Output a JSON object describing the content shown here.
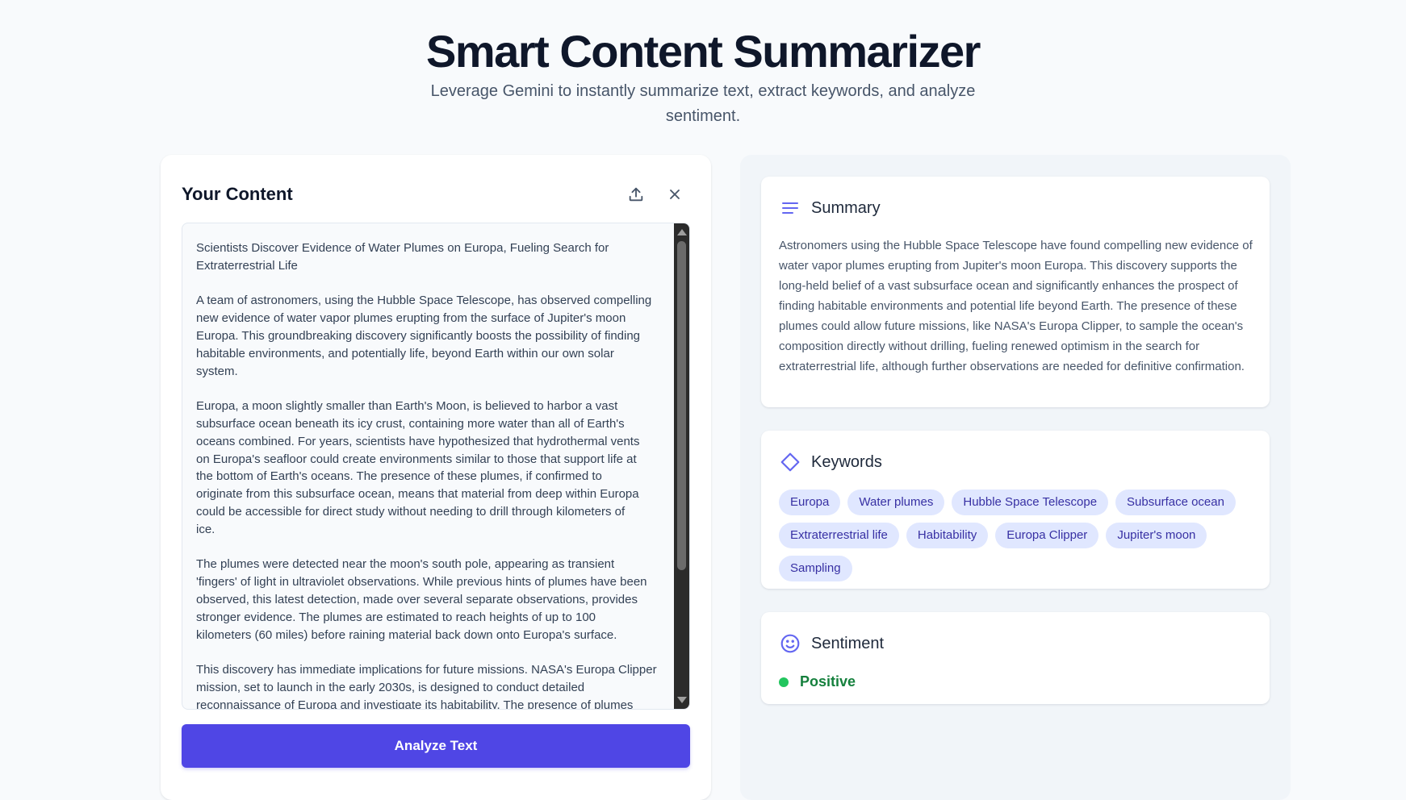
{
  "header": {
    "title": "Smart Content Summarizer",
    "subtitle": "Leverage Gemini to instantly summarize text, extract keywords, and analyze sentiment."
  },
  "input_panel": {
    "title": "Your Content",
    "upload_icon": "upload-icon",
    "close_icon": "close-icon",
    "text": "Scientists Discover Evidence of Water Plumes on Europa, Fueling Search for\nExtraterrestrial Life\n\nA team of astronomers, using the Hubble Space Telescope, has observed compelling\nnew evidence of water vapor plumes erupting from the surface of Jupiter's moon\nEuropa. This groundbreaking discovery significantly boosts the possibility of finding\nhabitable environments, and potentially life, beyond Earth within our own solar\nsystem.\n\nEuropa, a moon slightly smaller than Earth's Moon, is believed to harbor a vast\nsubsurface ocean beneath its icy crust, containing more water than all of Earth's\noceans combined. For years, scientists have hypothesized that hydrothermal vents\non Europa's seafloor could create environments similar to those that support life at\nthe bottom of Earth's oceans. The presence of these plumes, if confirmed to\noriginate from this subsurface ocean, means that material from deep within Europa\ncould be accessible for direct study without needing to drill through kilometers of\nice.\n\nThe plumes were detected near the moon's south pole, appearing as transient\n'fingers' of light in ultraviolet observations. While previous hints of plumes have been\nobserved, this latest detection, made over several separate observations, provides\nstronger evidence. The plumes are estimated to reach heights of up to 100\nkilometers (60 miles) before raining material back down onto Europa's surface.\n\nThis discovery has immediate implications for future missions. NASA's Europa Clipper\nmission, set to launch in the early 2030s, is designed to conduct detailed\nreconnaissance of Europa and investigate its habitability. The presence of plumes",
    "analyze_label": "Analyze Text"
  },
  "summary": {
    "title": "Summary",
    "icon": "lines-icon",
    "text": "Astronomers using the Hubble Space Telescope have found compelling new evidence of water vapor plumes erupting from Jupiter's moon Europa. This discovery supports the long-held belief of a vast subsurface ocean and significantly enhances the prospect of finding habitable environments and potential life beyond Earth. The presence of these plumes could allow future missions, like NASA's Europa Clipper, to sample the ocean's composition directly without drilling, fueling renewed optimism in the search for extraterrestrial life, although further observations are needed for definitive confirmation."
  },
  "keywords": {
    "title": "Keywords",
    "icon": "tag-icon",
    "items": [
      "Europa",
      "Water plumes",
      "Hubble Space Telescope",
      "Subsurface ocean",
      "Extraterrestrial life",
      "Habitability",
      "Europa Clipper",
      "Jupiter's moon",
      "Sampling"
    ]
  },
  "sentiment": {
    "title": "Sentiment",
    "icon": "smiley-icon",
    "value": "Positive",
    "color": "#22c55e",
    "text_color": "#15803d"
  },
  "colors": {
    "accent": "#4f46e5",
    "icon_accent": "#6366f1",
    "keyword_bg": "#e0e7ff",
    "keyword_text": "#3730a3"
  }
}
